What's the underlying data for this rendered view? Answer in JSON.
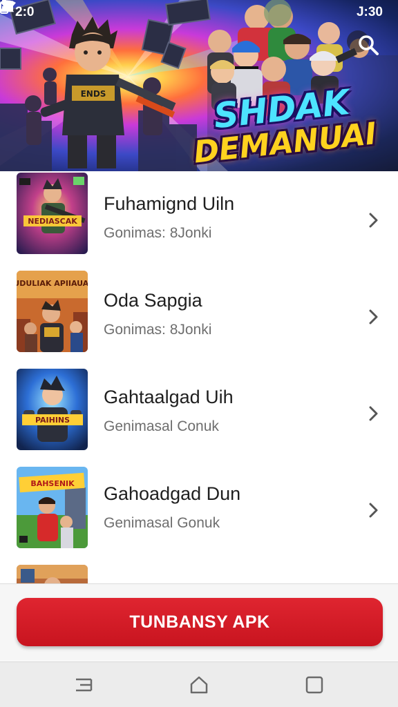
{
  "status_bar": {
    "time_left": "2:0",
    "time_right": "J:30",
    "icons": [
      "notification-icon",
      "wifi-icon",
      "signal-icon",
      "battery-icon"
    ]
  },
  "hero": {
    "title_line1": "SHDAK",
    "title_line2": "DEMANUAI",
    "search_icon": "search-icon"
  },
  "games": [
    {
      "title": "Fuhamignd Uiln",
      "subtitle": "Gonimas: 8Jonki",
      "thumb_text": "NEDIASCAK"
    },
    {
      "title": "Oda Sapgia",
      "subtitle": "Gonimas: 8Jonki",
      "thumb_text": "JUDULIAK APIIAUAK"
    },
    {
      "title": "Gahtaalgad Uih",
      "subtitle": "Genimasal Conuk",
      "thumb_text": "PAIHINS"
    },
    {
      "title": "Gahoadgad Dun",
      "subtitle": "Genimasal Gonuk",
      "thumb_text": "BAHSENIK"
    }
  ],
  "cta": {
    "label": "TUNBANSY APK"
  },
  "nav": {
    "icons": [
      "menu-icon",
      "home-icon",
      "recents-icon"
    ]
  },
  "colors": {
    "accent": "#d51c26",
    "title_text": "#1f1f1f",
    "subtitle_text": "#6e6e6e"
  }
}
